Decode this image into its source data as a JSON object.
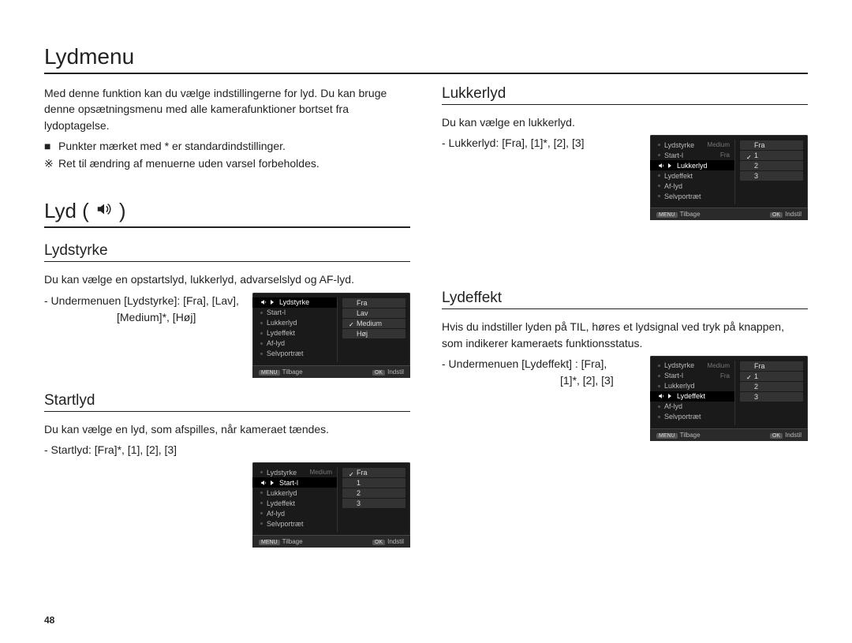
{
  "page": {
    "title": "Lydmenu",
    "intro": "Med denne funktion kan du vælge indstillingerne for lyd. Du kan bruge denne opsætningsmenu med alle kamerafunktioner bortset fra lydoptagelse.",
    "note1": "Punkter mærket med * er standardindstillinger.",
    "note2": "Ret til ændring af menuerne uden varsel forbeholdes.",
    "number": "48"
  },
  "lyd_section": {
    "heading": "Lyd (",
    "heading_close": ")"
  },
  "lydstyrke": {
    "heading": "Lydstyrke",
    "desc": "Du kan vælge en opstartslyd, lukkerlyd, advarselslyd og AF-lyd.",
    "sub_line1": "- Undermenuen [Lydstyrke]: [Fra], [Lav],",
    "sub_line2": "[Medium]*, [Høj]",
    "lcd": {
      "items": [
        "Lydstyrke",
        "Start-l",
        "Lukkerlyd",
        "Lydeffekt",
        "Af-lyd",
        "Selvportræt"
      ],
      "highlight": 0,
      "opts": [
        "Fra",
        "Lav",
        "Medium",
        "Høj"
      ],
      "opt_checked": 2,
      "right_values": [],
      "foot_left_tag": "MENU",
      "foot_left": "Tilbage",
      "foot_right_tag": "OK",
      "foot_right": "Indstil"
    }
  },
  "startlyd": {
    "heading": "Startlyd",
    "desc": "Du kan vælge en lyd, som afspilles, når kameraet tændes.",
    "sub": "- Startlyd: [Fra]*, [1], [2], [3]",
    "lcd": {
      "items": [
        "Lydstyrke",
        "Start-l",
        "Lukkerlyd",
        "Lydeffekt",
        "Af-lyd",
        "Selvportræt"
      ],
      "highlight": 1,
      "right_values": [
        "Medium",
        "",
        "",
        "",
        "",
        ""
      ],
      "opts": [
        "Fra",
        "1",
        "2",
        "3"
      ],
      "opt_checked": 0,
      "foot_left_tag": "MENU",
      "foot_left": "Tilbage",
      "foot_right_tag": "OK",
      "foot_right": "Indstil"
    }
  },
  "lukkerlyd": {
    "heading": "Lukkerlyd",
    "desc": "Du kan vælge en lukkerlyd.",
    "sub": "- Lukkerlyd: [Fra], [1]*, [2], [3]",
    "lcd": {
      "items": [
        "Lydstyrke",
        "Start-l",
        "Lukkerlyd",
        "Lydeffekt",
        "Af-lyd",
        "Selvportræt"
      ],
      "highlight": 2,
      "right_values": [
        "Medium",
        "Fra",
        "",
        "",
        "",
        ""
      ],
      "opts": [
        "Fra",
        "1",
        "2",
        "3"
      ],
      "opt_checked": 1,
      "foot_left_tag": "MENU",
      "foot_left": "Tilbage",
      "foot_right_tag": "OK",
      "foot_right": "Indstil"
    }
  },
  "lydeffekt": {
    "heading": "Lydeffekt",
    "desc": "Hvis du indstiller lyden på TIL, høres et lydsignal ved tryk på knappen, som indikerer kameraets funktionsstatus.",
    "sub_line1": "- Undermenuen [Lydeffekt] : [Fra],",
    "sub_line2": "[1]*, [2], [3]",
    "lcd": {
      "items": [
        "Lydstyrke",
        "Start-l",
        "Lukkerlyd",
        "Lydeffekt",
        "Af-lyd",
        "Selvportræt"
      ],
      "highlight": 3,
      "right_values": [
        "Medium",
        "Fra",
        "",
        "",
        "",
        ""
      ],
      "opts": [
        "Fra",
        "1",
        "2",
        "3"
      ],
      "opt_checked": 1,
      "foot_left_tag": "MENU",
      "foot_left": "Tilbage",
      "foot_right_tag": "OK",
      "foot_right": "Indstil"
    }
  }
}
